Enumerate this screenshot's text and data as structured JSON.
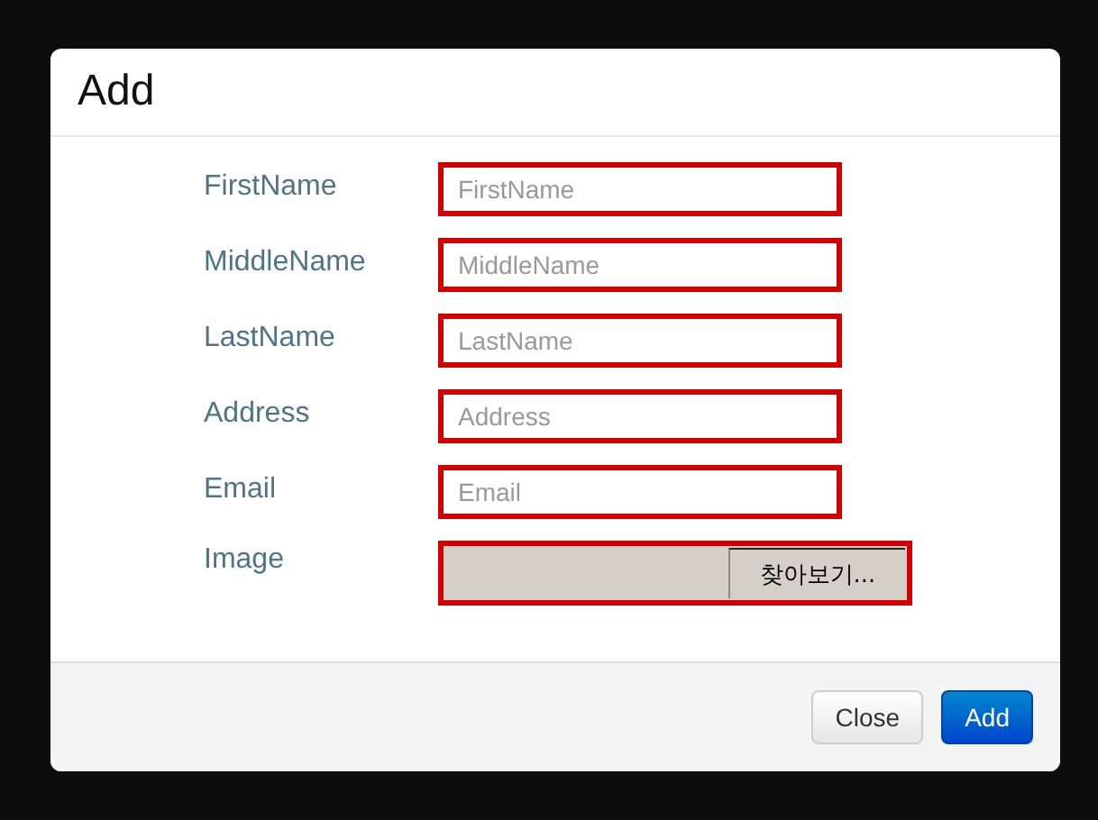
{
  "dialog": {
    "title": "Add",
    "fields": [
      {
        "kind": "text",
        "label": "FirstName",
        "placeholder": "FirstName"
      },
      {
        "kind": "text",
        "label": "MiddleName",
        "placeholder": "MiddleName"
      },
      {
        "kind": "text",
        "label": "LastName",
        "placeholder": "LastName"
      },
      {
        "kind": "text",
        "label": "Address",
        "placeholder": "Address"
      },
      {
        "kind": "text",
        "label": "Email",
        "placeholder": "Email"
      },
      {
        "kind": "file",
        "label": "Image",
        "button": "찾아보기..."
      }
    ],
    "buttons": [
      {
        "label": "Close",
        "kind": "default"
      },
      {
        "label": "Add",
        "kind": "primary"
      }
    ]
  }
}
